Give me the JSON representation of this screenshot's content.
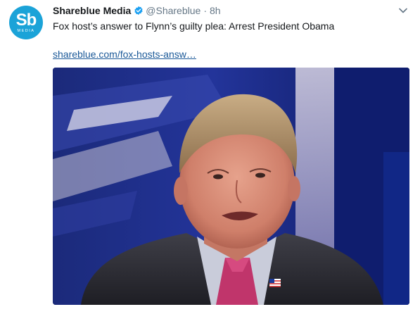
{
  "tweet": {
    "author_name": "Shareblue Media",
    "handle": "@Shareblue",
    "separator": "·",
    "time": "8h",
    "text": "Fox host’s answer to Flynn’s guilty plea: Arrest President Obama",
    "link_text": "shareblue.com/fox-hosts-answ…"
  },
  "avatar": {
    "monogram": "Sb",
    "subtext": "MEDIA",
    "color": "#1ba3d8"
  },
  "icons": {
    "verified": "verified-badge-icon",
    "more": "chevron-down-icon"
  },
  "colors": {
    "link": "#1b5998",
    "secondary_text": "#657786",
    "verified": "#1da1f2"
  }
}
